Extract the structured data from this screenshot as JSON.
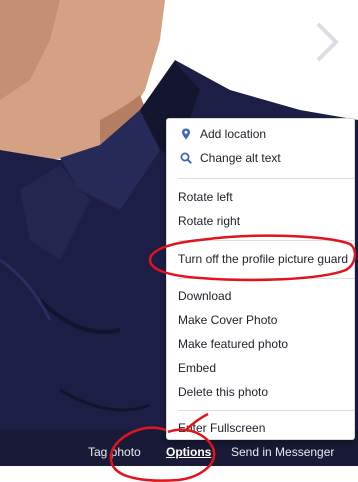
{
  "photo": {
    "background_color": "#ffffff",
    "shirt_color": "#1c1e45",
    "skin_color": "#d4a184",
    "accent_color": "#4b4f56"
  },
  "viewer": {
    "next_arrow_icon": "chevron-right-icon"
  },
  "options_menu": {
    "icon_color": "#4267b2",
    "groups": [
      {
        "items": [
          {
            "label": "Add location",
            "icon": "location-pin-icon"
          },
          {
            "label": "Change alt text",
            "icon": "search-icon"
          }
        ]
      },
      {
        "items": [
          {
            "label": "Rotate left"
          },
          {
            "label": "Rotate right"
          }
        ]
      },
      {
        "items": [
          {
            "label": "Turn off the profile picture guard"
          }
        ]
      },
      {
        "items": [
          {
            "label": "Download"
          },
          {
            "label": "Make Cover Photo"
          },
          {
            "label": "Make featured photo"
          },
          {
            "label": "Embed"
          },
          {
            "label": "Delete this photo"
          }
        ]
      },
      {
        "items": [
          {
            "label": "Enter Fullscreen"
          }
        ]
      }
    ]
  },
  "action_bar": {
    "tag_photo": "Tag photo",
    "options": "Options",
    "send_in_messenger": "Send in Messenger"
  },
  "annotations": {
    "color": "#e0141e"
  }
}
